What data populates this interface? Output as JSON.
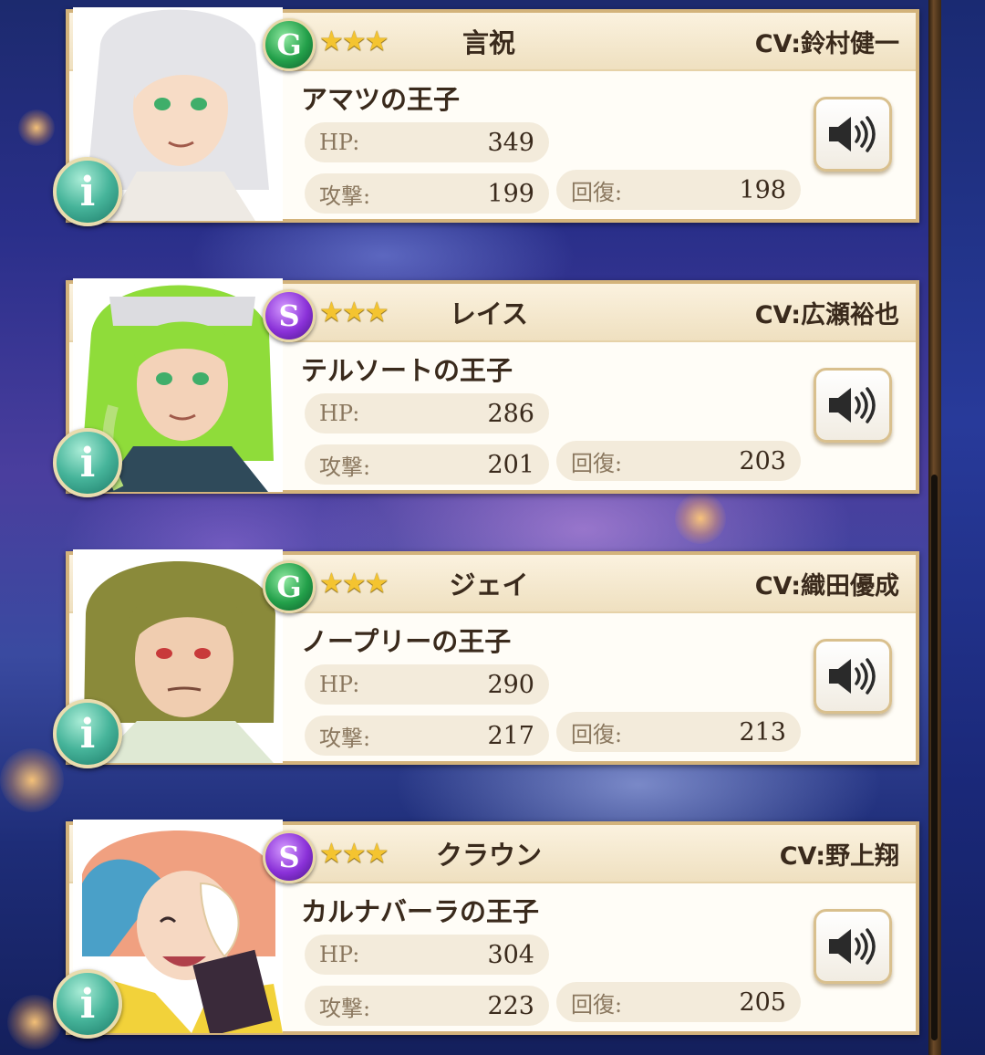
{
  "labels": {
    "hp": "HP:",
    "attack": "攻撃:",
    "recovery": "回復:"
  },
  "colors": {
    "card_border": "#d3b37b",
    "attr_g": "#23a04a",
    "attr_s": "#8a31d8",
    "info": "#46b49a",
    "star": "#f4c430"
  },
  "characters": [
    {
      "name": "言祝",
      "cv": "CV:鈴村健一",
      "title": "アマツの王子",
      "attribute": "G",
      "stars": "★★★",
      "hp": "349",
      "attack": "199",
      "recovery": "198",
      "hair": "#e4e4e8",
      "eyes": "#3fae6a"
    },
    {
      "name": "レイス",
      "cv": "CV:広瀬裕也",
      "title": "テルソートの王子",
      "attribute": "S",
      "stars": "★★★",
      "hp": "286",
      "attack": "201",
      "recovery": "203",
      "hair": "#8fdc3a",
      "eyes": "#3fae6a"
    },
    {
      "name": "ジェイ",
      "cv": "CV:織田優成",
      "title": "ノープリーの王子",
      "attribute": "G",
      "stars": "★★★",
      "hp": "290",
      "attack": "217",
      "recovery": "213",
      "hair": "#8a8a3a",
      "eyes": "#c83a3a"
    },
    {
      "name": "クラウン",
      "cv": "CV:野上翔",
      "title": "カルナバーラの王子",
      "attribute": "S",
      "stars": "★★★",
      "hp": "304",
      "attack": "223",
      "recovery": "205",
      "hair": "#f0a080",
      "eyes": "#4a8ad0"
    }
  ],
  "icons": {
    "attribute": "attribute-badge-icon",
    "sound": "speaker-icon",
    "info": "info-icon"
  },
  "info_glyph": "i"
}
